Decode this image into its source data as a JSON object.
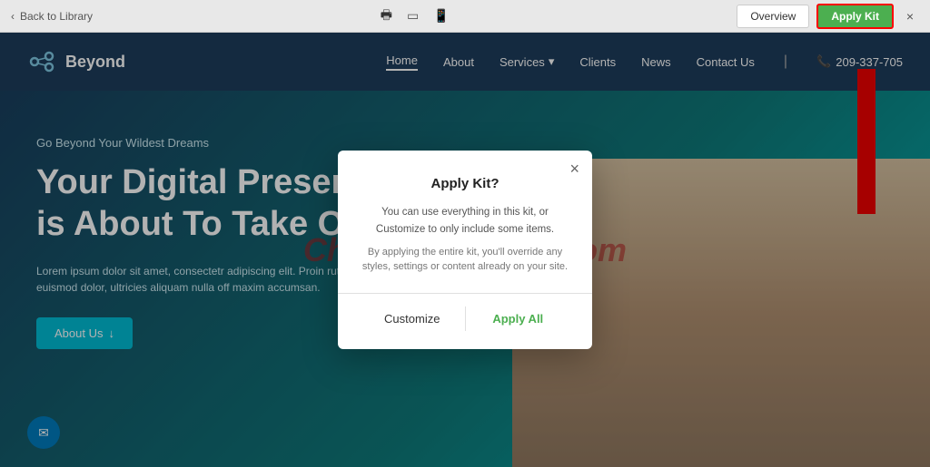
{
  "topbar": {
    "back_label": "Back to Library",
    "overview_label": "Overview",
    "apply_kit_label": "Apply Kit",
    "close_icon": "×"
  },
  "devices": [
    {
      "name": "desktop",
      "icon": "🖥",
      "active": true
    },
    {
      "name": "tablet",
      "icon": "▭",
      "active": false
    },
    {
      "name": "mobile",
      "icon": "📱",
      "active": false
    }
  ],
  "nav": {
    "logo_text": "Beyond",
    "links": [
      {
        "label": "Home",
        "active": true
      },
      {
        "label": "About",
        "active": false
      },
      {
        "label": "Services",
        "has_dropdown": true
      },
      {
        "label": "Clients",
        "active": false
      },
      {
        "label": "News",
        "active": false
      },
      {
        "label": "Contact Us",
        "active": false
      }
    ],
    "phone": "209-337-705"
  },
  "hero": {
    "subtitle": "Go Beyond Your Wildest Dreams",
    "title": "Your Digital Presence is About To Take Off",
    "body": "Lorem ipsum dolor sit amet, consectetr adipiscing elit. Proin rutrum euismod dolor, ultricies aliquam nulla off  maxim accumsan.",
    "cta_label": "About Us",
    "cta_arrow": "↓"
  },
  "watermark": "ChiasePremium.com",
  "modal": {
    "title": "Apply Kit?",
    "text_primary": "You can use everything in this kit, or Customize to only include some items.",
    "text_secondary": "By applying the entire kit, you'll override any styles, settings or content already on your site.",
    "customize_label": "Customize",
    "apply_label": "Apply All",
    "close_icon": "×"
  }
}
